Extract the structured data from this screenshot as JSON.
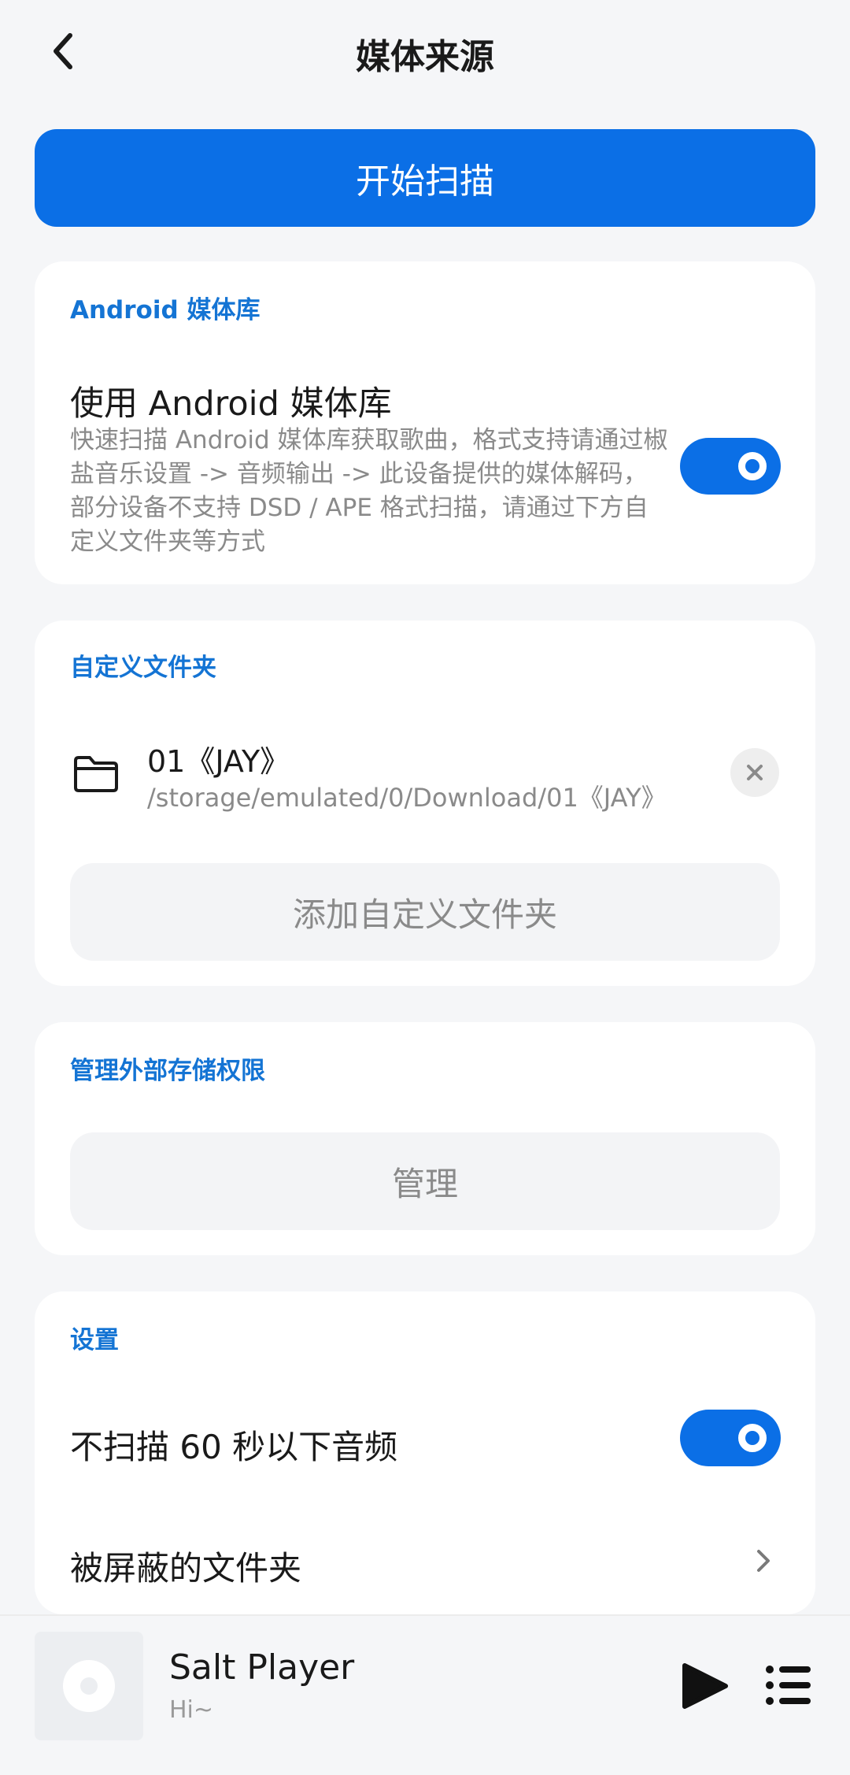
{
  "header": {
    "title": "媒体来源"
  },
  "scan_button": {
    "label": "开始扫描"
  },
  "android_library": {
    "section_label": "Android 媒体库",
    "use_title": "使用 Android 媒体库",
    "use_desc": "快速扫描 Android 媒体库获取歌曲，格式支持请通过椒盐音乐设置 -> 音频输出 -> 此设备提供的媒体解码，部分设备不支持 DSD / APE 格式扫描，请通过下方自定义文件夹等方式",
    "enabled": true
  },
  "custom_folders": {
    "section_label": "自定义文件夹",
    "items": [
      {
        "name": "01《JAY》",
        "path": "/storage/emulated/0/Download/01《JAY》"
      }
    ],
    "add_label": "添加自定义文件夹"
  },
  "storage_permission": {
    "section_label": "管理外部存储权限",
    "manage_label": "管理"
  },
  "settings": {
    "section_label": "设置",
    "skip_short_label": "不扫描 60 秒以下音频",
    "skip_short_enabled": true,
    "blocked_folders_label": "被屏蔽的文件夹"
  },
  "player": {
    "title": "Salt Player",
    "subtitle": "Hi~"
  },
  "colors": {
    "accent": "#0b6fe6",
    "section_label": "#1474d4",
    "background": "#f5f6f8"
  },
  "icons": {
    "back": "chevron-left-icon",
    "folder": "folder-icon",
    "remove": "close-icon",
    "chevron": "chevron-right-icon",
    "album": "disc-icon",
    "play": "play-icon",
    "playlist": "playlist-icon"
  }
}
